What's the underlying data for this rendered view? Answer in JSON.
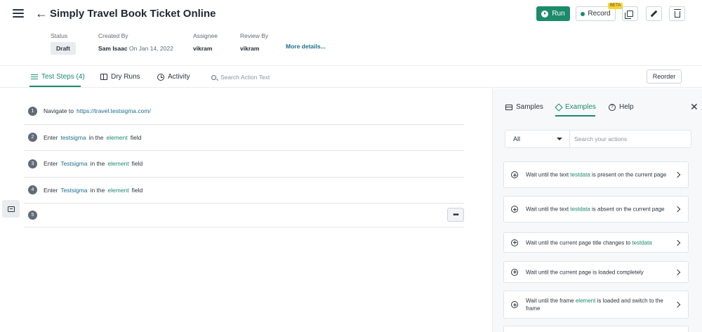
{
  "header": {
    "title": "Simply Travel Book Ticket Online",
    "run_label": "Run",
    "record_label": "Record",
    "beta_label": "BETA"
  },
  "meta": {
    "status_label": "Status",
    "status_value": "Draft",
    "created_by_label": "Created By",
    "created_by_name": "Sam Isaac",
    "created_on": "On Jan 14, 2022",
    "assignee_label": "Assignee",
    "assignee_value": "vikram",
    "review_by_label": "Review By",
    "review_by_value": "vikram",
    "more_details": "More details..."
  },
  "tabs": {
    "test_steps": "Test Steps (4)",
    "dry_runs": "Dry Runs",
    "activity": "Activity",
    "search_placeholder": "Search Action Text",
    "reorder": "Reorder"
  },
  "steps": [
    {
      "num": "1",
      "pre": "Navigate to",
      "url": "https://travel.testsigma.com/"
    },
    {
      "num": "2",
      "pre": "Enter",
      "data": "testsigma",
      "mid": "in the",
      "el": "element",
      "post": "field"
    },
    {
      "num": "3",
      "pre": "Enter",
      "data": "Testsigma",
      "mid": "in the",
      "el": "element",
      "post": "field"
    },
    {
      "num": "4",
      "pre": "Enter",
      "data": "Testsigma",
      "mid": "in the",
      "el": "element",
      "post": "field"
    },
    {
      "num": "5",
      "more": "•••"
    }
  ],
  "panel": {
    "samples": "Samples",
    "examples": "Examples",
    "help": "Help",
    "filter_value": "All",
    "search_placeholder": "Search your actions",
    "cards": [
      {
        "a": "Wait until the text",
        "b": "testdata",
        "c": "is present on the current page"
      },
      {
        "a": "Wait until the text",
        "b": "testdata",
        "c": "is absent on the current page"
      },
      {
        "a": "Wait until the current page title changes to",
        "b": "testdata",
        "c": ""
      },
      {
        "a": "Wait until the current page is loaded completely",
        "b": "",
        "c": ""
      },
      {
        "a": "Wait until the frame",
        "b": "element",
        "c": "is loaded and switch to the frame"
      }
    ]
  },
  "colors": {
    "accent": "#1c8b6b",
    "link": "#1c6e8b"
  }
}
